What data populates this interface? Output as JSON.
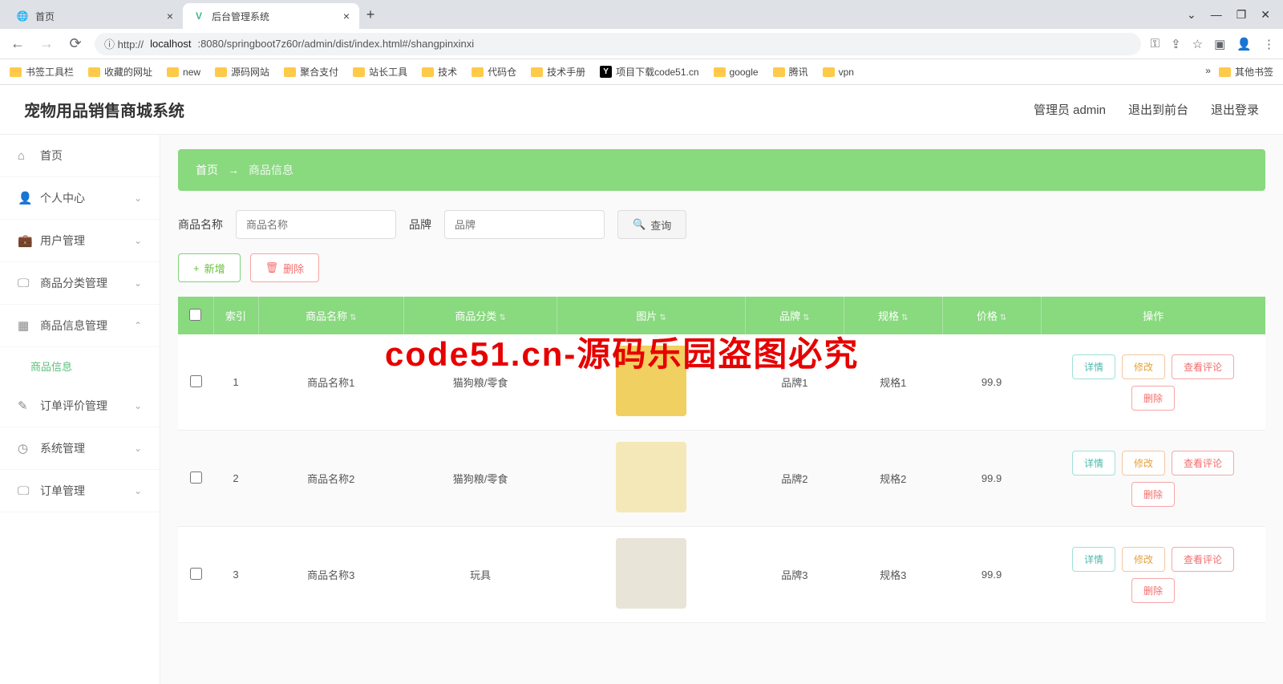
{
  "browser": {
    "tabs": [
      {
        "title": "首页",
        "favicon": "globe"
      },
      {
        "title": "后台管理系统",
        "favicon": "vue"
      }
    ],
    "url_prefix": "ⓘ http://",
    "url_host": "localhost",
    "url_path": ":8080/springboot7z60r/admin/dist/index.html#/shangpinxinxi",
    "bookmarks": [
      "书签工具栏",
      "收藏的网址",
      "new",
      "源码网站",
      "聚合支付",
      "站长工具",
      "技术",
      "代码仓",
      "技术手册"
    ],
    "bookmark_special": "项目下载code51.cn",
    "bookmarks2": [
      "google",
      "腾讯",
      "vpn"
    ],
    "bookmark_other": "其他书签"
  },
  "header": {
    "title": "宠物用品销售商城系统",
    "user": "管理员 admin",
    "exit_front": "退出到前台",
    "logout": "退出登录"
  },
  "sidebar": {
    "items": [
      {
        "icon": "⌂",
        "label": "首页",
        "expandable": false
      },
      {
        "icon": "👤",
        "label": "个人中心",
        "expandable": true
      },
      {
        "icon": "💼",
        "label": "用户管理",
        "expandable": true
      },
      {
        "icon": "🖵",
        "label": "商品分类管理",
        "expandable": true
      },
      {
        "icon": "▦",
        "label": "商品信息管理",
        "expandable": true,
        "open": true
      },
      {
        "icon": "✎",
        "label": "订单评价管理",
        "expandable": true
      },
      {
        "icon": "◷",
        "label": "系统管理",
        "expandable": true
      },
      {
        "icon": "🖵",
        "label": "订单管理",
        "expandable": true
      }
    ],
    "sub_active": "商品信息"
  },
  "breadcrumb": {
    "home": "首页",
    "arrow": "→",
    "current": "商品信息"
  },
  "search": {
    "name_label": "商品名称",
    "name_placeholder": "商品名称",
    "brand_label": "品牌",
    "brand_placeholder": "品牌",
    "search_btn": "查询"
  },
  "actions": {
    "add": "新增",
    "delete": "删除"
  },
  "table": {
    "headers": [
      "",
      "索引",
      "商品名称",
      "商品分类",
      "图片",
      "品牌",
      "规格",
      "价格",
      "操作"
    ],
    "rows": [
      {
        "idx": "1",
        "name": "商品名称1",
        "cat": "猫狗粮/零食",
        "brand": "品牌1",
        "spec": "规格1",
        "price": "99.9"
      },
      {
        "idx": "2",
        "name": "商品名称2",
        "cat": "猫狗粮/零食",
        "brand": "品牌2",
        "spec": "规格2",
        "price": "99.9"
      },
      {
        "idx": "3",
        "name": "商品名称3",
        "cat": "玩具",
        "brand": "品牌3",
        "spec": "规格3",
        "price": "99.9"
      }
    ],
    "ops": {
      "detail": "详情",
      "edit": "修改",
      "comment": "查看评论",
      "del": "删除"
    }
  },
  "watermark": "code51.cn-源码乐园盗图必究"
}
